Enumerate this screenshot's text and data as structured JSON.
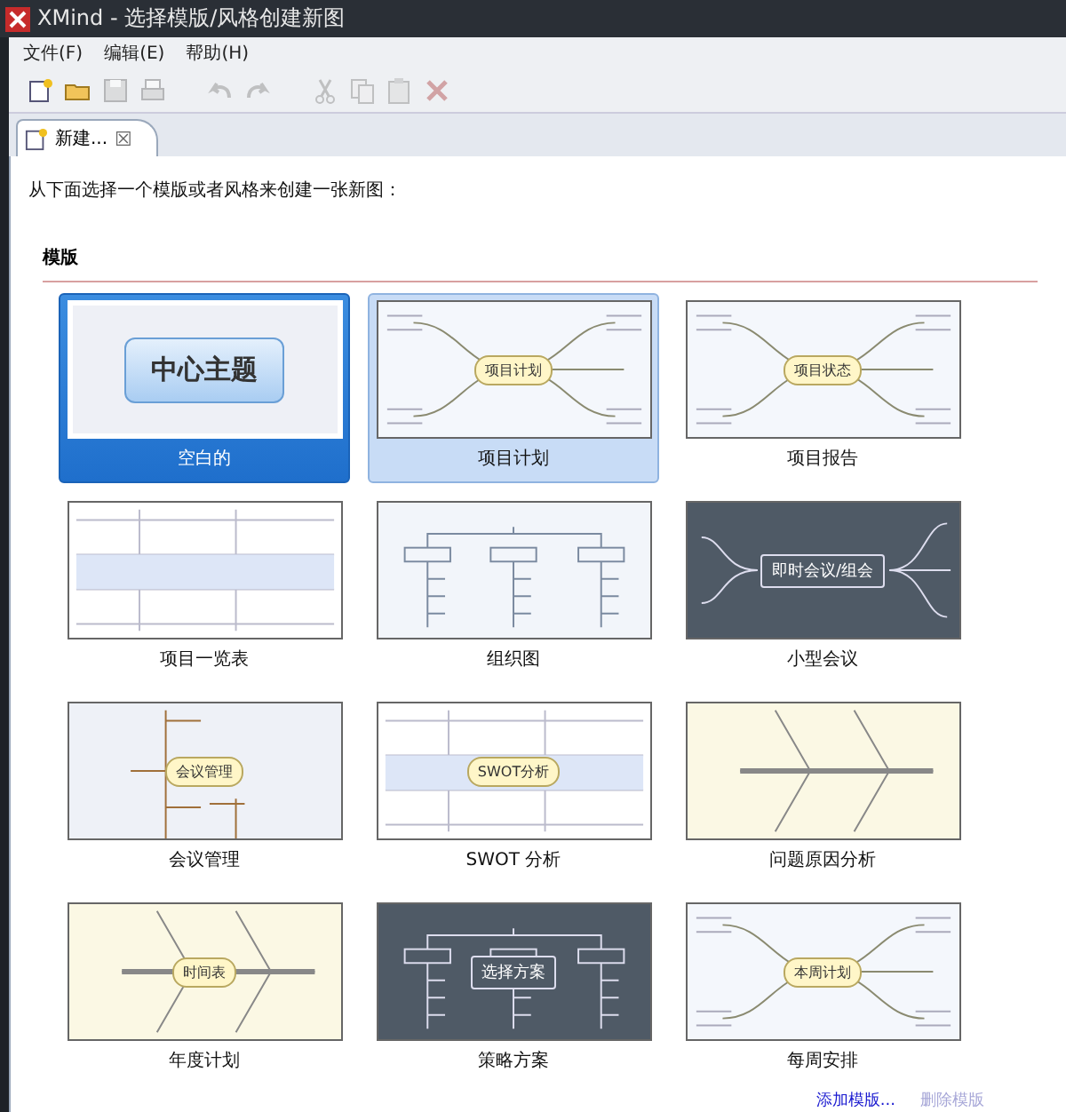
{
  "window": {
    "title": "XMind - 选择模版/风格创建新图"
  },
  "menu": [
    "文件(F)",
    "编辑(E)",
    "帮助(H)"
  ],
  "toolbar": [
    {
      "kind": "new",
      "disabled": false
    },
    {
      "kind": "open",
      "disabled": false
    },
    {
      "kind": "save",
      "disabled": true
    },
    {
      "kind": "print",
      "disabled": true
    },
    {
      "kind": "undo",
      "disabled": true
    },
    {
      "kind": "redo",
      "disabled": true
    },
    {
      "kind": "cut",
      "disabled": true
    },
    {
      "kind": "copy",
      "disabled": true
    },
    {
      "kind": "paste",
      "disabled": true
    },
    {
      "kind": "delete",
      "disabled": true
    }
  ],
  "tab": {
    "label": "新建...",
    "close": "☒"
  },
  "instruction": "从下面选择一个模版或者风格来创建一张新图：",
  "section": "模版",
  "templates": [
    {
      "name": "空白的",
      "selected": true,
      "hovered": false,
      "kind": "blank",
      "center": "中心主题"
    },
    {
      "name": "项目计划",
      "selected": false,
      "hovered": true,
      "kind": "mindmap",
      "center": "项目计划"
    },
    {
      "name": "项目报告",
      "selected": false,
      "hovered": false,
      "kind": "mindmap",
      "center": "项目状态"
    },
    {
      "name": "项目一览表",
      "selected": false,
      "hovered": false,
      "kind": "table"
    },
    {
      "name": "组织图",
      "selected": false,
      "hovered": false,
      "kind": "org"
    },
    {
      "name": "小型会议",
      "selected": false,
      "hovered": false,
      "kind": "dark",
      "center": "即时会议/组会"
    },
    {
      "name": "会议管理",
      "selected": false,
      "hovered": false,
      "kind": "tree",
      "center": "会议管理"
    },
    {
      "name": "SWOT 分析",
      "selected": false,
      "hovered": false,
      "kind": "table",
      "center": "SWOT分析"
    },
    {
      "name": "问题原因分析",
      "selected": false,
      "hovered": false,
      "kind": "fishbone"
    },
    {
      "name": "年度计划",
      "selected": false,
      "hovered": false,
      "kind": "fishbone",
      "center": "时间表"
    },
    {
      "name": "策略方案",
      "selected": false,
      "hovered": false,
      "kind": "darkorg",
      "center": "选择方案"
    },
    {
      "name": "每周安排",
      "selected": false,
      "hovered": false,
      "kind": "mindmap",
      "center": "本周计划"
    }
  ],
  "links": [
    {
      "label": "添加模版...",
      "disabled": false
    },
    {
      "label": "删除模版",
      "disabled": true
    }
  ]
}
